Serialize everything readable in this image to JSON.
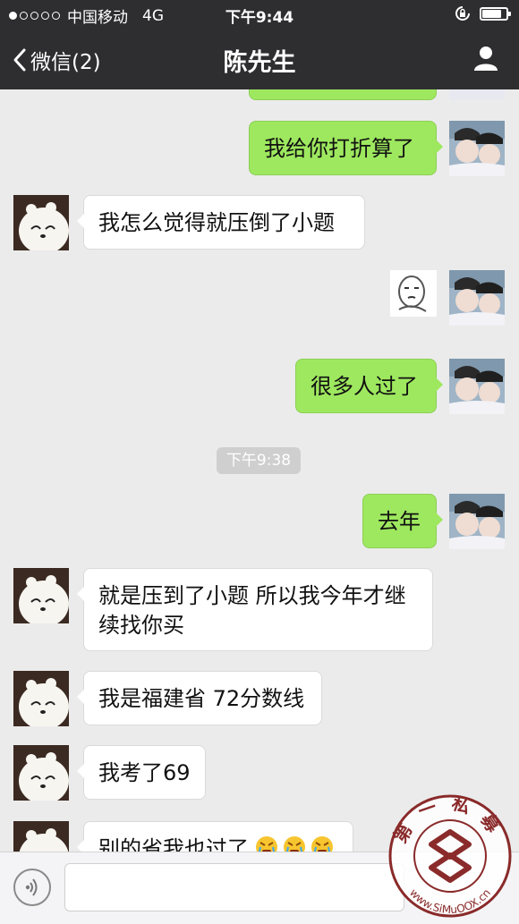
{
  "status": {
    "carrier": "中国移动",
    "network": "4G",
    "time": "下午9:44",
    "battery_level": 0.8
  },
  "nav": {
    "back_label": "微信(2)",
    "title": "陈先生"
  },
  "chat": {
    "timestamp": "下午9:38",
    "messages": [
      {
        "from": "me",
        "text": "我给你打折算了"
      },
      {
        "from": "other",
        "text": "我怎么觉得就压倒了小题"
      },
      {
        "from": "me",
        "type": "sticker",
        "icon": "face-sticker-icon"
      },
      {
        "from": "me",
        "text": "很多人过了"
      },
      {
        "from": "me",
        "text": "去年"
      },
      {
        "from": "other",
        "text": "就是压到了小题 所以我今年才继续找你买"
      },
      {
        "from": "other",
        "text": "我是福建省 72分数线"
      },
      {
        "from": "other",
        "text": "我考了69"
      },
      {
        "from": "other",
        "text": "别的省我也过了",
        "emoji": "angry-cry-emoji"
      }
    ]
  },
  "watermark": {
    "text": "第一私募",
    "url": "www.SiMuOOX.cn"
  },
  "colors": {
    "nav_bg": "#2e2e30",
    "chat_bg": "#ebebeb",
    "bubble_out": "#9ee85f",
    "bubble_in": "#ffffff"
  }
}
